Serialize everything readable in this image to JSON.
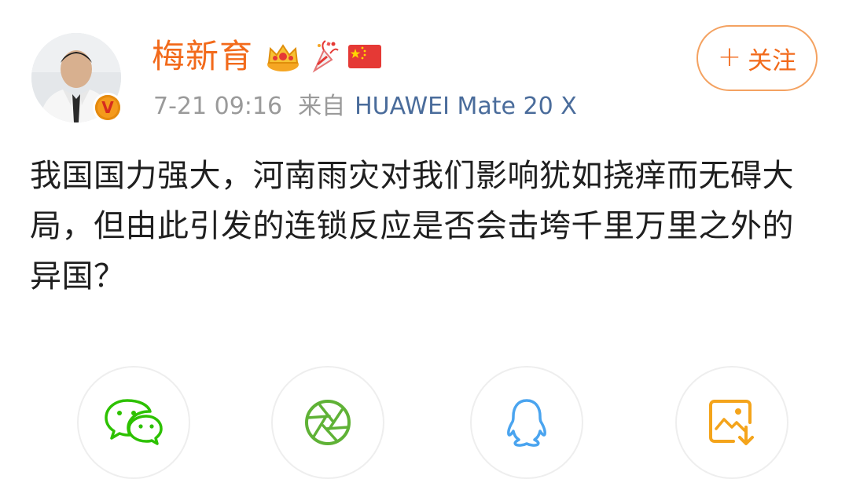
{
  "user": {
    "name": "梅新育",
    "verified_badge": "V"
  },
  "post": {
    "time": "7-21 09:16",
    "source_prefix": "来自",
    "source": "HUAWEI Mate 20 X",
    "text": "我国国力强大，河南雨灾对我们影响犹如挠痒而无碍大局，但由此引发的连锁反应是否会击垮千里万里之外的异国？"
  },
  "follow": {
    "plus": "+",
    "label": "关注"
  },
  "badges": [
    "crown-icon",
    "party-popper-icon",
    "china-flag-icon"
  ],
  "share": [
    "wechat-icon",
    "moments-icon",
    "qq-icon",
    "save-image-icon"
  ],
  "colors": {
    "accent": "#f26a1b",
    "link": "#4a6c9b",
    "muted": "#9a9a9a",
    "wechat": "#2dc100",
    "moments": "#5fb236",
    "qq": "#4aa4ef",
    "save": "#f4a41b"
  }
}
